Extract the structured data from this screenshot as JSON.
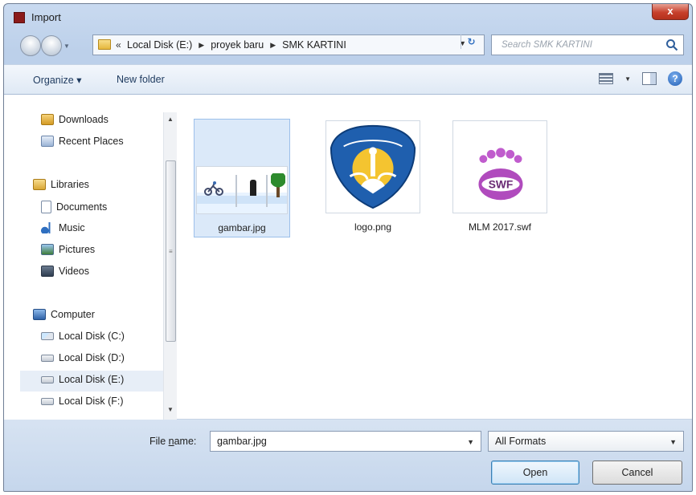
{
  "window": {
    "title": "Import",
    "close_label": "x"
  },
  "address": {
    "overflow_chevron": "«",
    "breadcrumbs": [
      "Local Disk (E:)",
      "proyek baru",
      "SMK KARTINI"
    ],
    "search_placeholder": "Search SMK KARTINI"
  },
  "toolbar": {
    "organize_label": "Organize ▾",
    "new_folder_label": "New folder",
    "help_label": "?"
  },
  "sidebar": {
    "items": [
      {
        "label": "Downloads",
        "icon": "downloads-icon"
      },
      {
        "label": "Recent Places",
        "icon": "recent-places-icon"
      },
      {
        "label": "Libraries",
        "icon": "libraries-icon"
      },
      {
        "label": "Documents",
        "icon": "documents-icon"
      },
      {
        "label": "Music",
        "icon": "music-icon"
      },
      {
        "label": "Pictures",
        "icon": "pictures-icon"
      },
      {
        "label": "Videos",
        "icon": "videos-icon"
      },
      {
        "label": "Computer",
        "icon": "computer-icon"
      },
      {
        "label": "Local Disk (C:)",
        "icon": "system-drive-icon"
      },
      {
        "label": "Local Disk (D:)",
        "icon": "drive-icon"
      },
      {
        "label": "Local Disk (E:)",
        "icon": "drive-icon",
        "selected": true
      },
      {
        "label": "Local Disk (F:)",
        "icon": "drive-icon"
      }
    ]
  },
  "files": [
    {
      "name": "gambar.jpg",
      "selected": true
    },
    {
      "name": "logo.png",
      "selected": false
    },
    {
      "name": "MLM 2017.swf",
      "selected": false,
      "badge": "SWF"
    }
  ],
  "footer": {
    "file_name_label_pre": "File ",
    "file_name_label_accel": "n",
    "file_name_label_post": "ame:",
    "file_name_value": "gambar.jpg",
    "file_type_value": "All Formats",
    "open_label": "Open",
    "cancel_label": "Cancel"
  },
  "colors": {
    "selection": "#dbe9f9",
    "logo_blue": "#1f5fae",
    "swf_purple": "#b04bbd"
  }
}
